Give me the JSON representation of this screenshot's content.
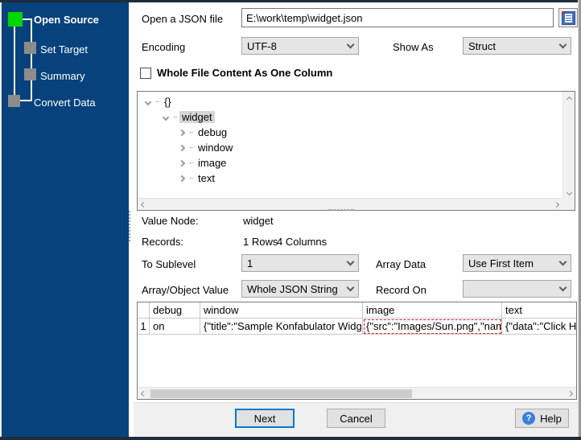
{
  "sidebar": {
    "steps": [
      {
        "label": "Open Source",
        "active": true
      },
      {
        "label": "Set Target",
        "active": false
      },
      {
        "label": "Summary",
        "active": false
      },
      {
        "label": "Convert Data",
        "active": false
      }
    ]
  },
  "file_row": {
    "label": "Open a JSON file",
    "value": "E:\\work\\temp\\widget.json",
    "browse_icon": "file-document-icon"
  },
  "options": {
    "encoding_label": "Encoding",
    "encoding_value": "UTF-8",
    "show_as_label": "Show As",
    "show_as_value": "Struct",
    "checkbox_label": "Whole File Content As One Column",
    "checkbox_checked": false
  },
  "tree": {
    "items": [
      {
        "label": "{}",
        "level": 0,
        "state": "expanded",
        "selected": false
      },
      {
        "label": "widget",
        "level": 1,
        "state": "expanded",
        "selected": true
      },
      {
        "label": "debug",
        "level": 2,
        "state": "collapsed",
        "selected": false
      },
      {
        "label": "window",
        "level": 2,
        "state": "collapsed",
        "selected": false
      },
      {
        "label": "image",
        "level": 2,
        "state": "collapsed",
        "selected": false
      },
      {
        "label": "text",
        "level": 2,
        "state": "collapsed",
        "selected": false
      }
    ]
  },
  "info": {
    "value_node_label": "Value Node:",
    "value_node": "widget",
    "records_label": "Records:",
    "rows": "1 Rows",
    "columns": "4 Columns"
  },
  "selects": {
    "to_sublevel_label": "To Sublevel",
    "to_sublevel_value": "1",
    "array_data_label": "Array Data",
    "array_data_value": "Use First Item",
    "array_object_label": "Array/Object Value",
    "array_object_value": "Whole JSON String",
    "record_on_label": "Record On",
    "record_on_value": ""
  },
  "grid": {
    "columns": [
      "debug",
      "window",
      "image",
      "text"
    ],
    "rows": [
      {
        "num": "1",
        "debug": "on",
        "window": "{\"title\":\"Sample Konfabulator Widget\"",
        "image": "{\"src\":\"Images/Sun.png\",\"name\":\"",
        "text": "{\"data\":\"Click Here\""
      }
    ]
  },
  "buttons": {
    "next": "Next",
    "cancel": "Cancel",
    "help": "Help"
  },
  "icons": {
    "browse": "file-document-icon",
    "combo_arrow": "chevron-down",
    "tree_expanded": "chevron-down",
    "tree_collapsed": "chevron-right",
    "help": "question-mark-circle"
  },
  "colors": {
    "sidebar_blue": "#07427C",
    "active_step_green": "#00D600",
    "idle_step_gray": "#8C8C8C",
    "next_button_focus": "#0078D7",
    "help_icon_blue": "#3C7EDB",
    "grid_focus_cell_red": "#E02020"
  }
}
